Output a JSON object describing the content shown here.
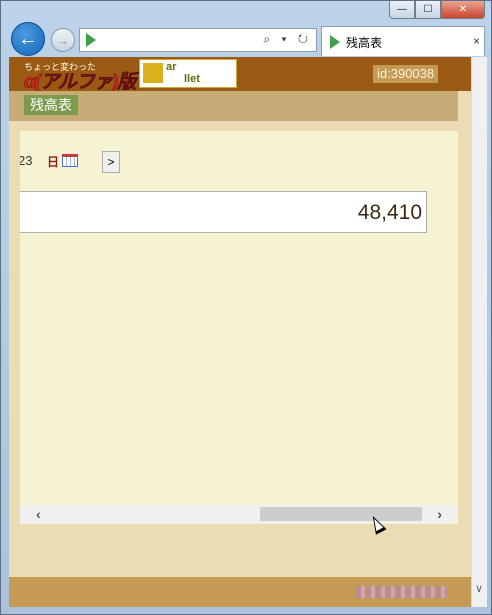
{
  "window": {
    "minimize_label": "—",
    "maximize_label": "☐",
    "close_label": "✕"
  },
  "browser": {
    "back_label": "←",
    "forward_label": "→",
    "address_tools": "⌕ ▾ ↻",
    "tab_title": "残高表",
    "tab_close": "×"
  },
  "site": {
    "logo_small": "ちょっと変わった",
    "logo_main": "α(アルファ)版",
    "logo_box_top": "ar",
    "logo_box_bottom": "llet",
    "user_id": "id:390038"
  },
  "menu": {
    "active_tab": "残高表"
  },
  "panel": {
    "date_fragment": "23",
    "day_link": "日",
    "next_label": ">",
    "balance": "48,410"
  },
  "scroll": {
    "left_arrow": "‹",
    "right_arrow": "›",
    "down_arrow": "∨"
  }
}
